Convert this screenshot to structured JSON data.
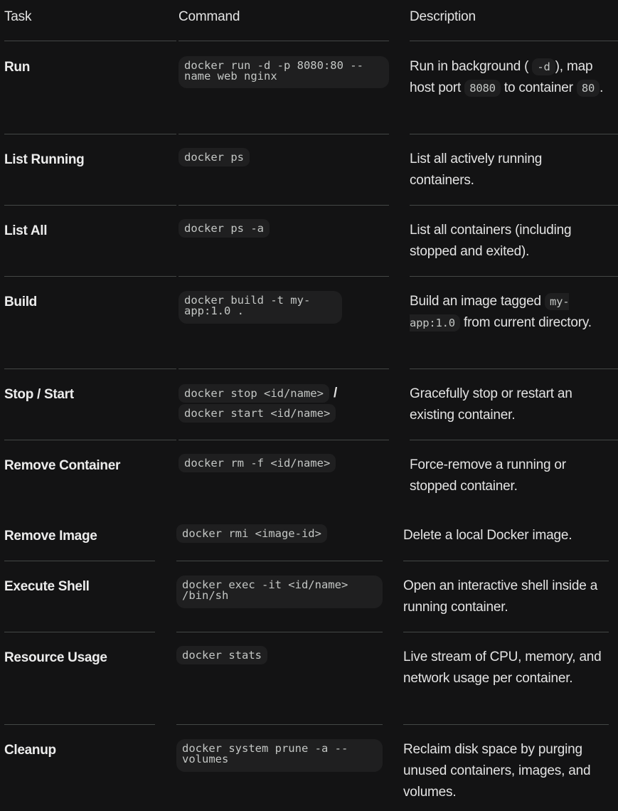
{
  "headers": {
    "task": "Task",
    "command": "Command",
    "description": "Description"
  },
  "rows": [
    {
      "task": "Run",
      "command": "docker run -d -p 8080:80 --name web nginx",
      "desc": {
        "p1": "Run in background (",
        "c1": "-d",
        "p2": "), map host port",
        "c2": "8080",
        "p3": "to container",
        "c3": "80",
        "p4": "."
      }
    },
    {
      "task": "List Running",
      "command": "docker ps",
      "desc": "List all actively running containers."
    },
    {
      "task": "List All",
      "command": "docker ps -a",
      "desc": "List all containers (including stopped and exited)."
    },
    {
      "task": "Build",
      "command": "docker build -t my-app:1.0 .",
      "desc": {
        "p1": "Build an image tagged",
        "c1": "my-app:1.0",
        "p2": "from current directory."
      }
    },
    {
      "task": "Stop / Start",
      "command_stop": "docker stop <id/name>",
      "separator": "/",
      "command_start": "docker start <id/name>",
      "desc": "Gracefully stop or restart an existing container."
    },
    {
      "task": "Remove Container",
      "command": "docker rm -f <id/name>",
      "desc": "Force-remove a running or stopped container."
    },
    {
      "task": "Remove Image",
      "command": "docker rmi <image-id>",
      "desc": "Delete a local Docker image."
    },
    {
      "task": "Execute Shell",
      "command": "docker exec -it <id/name> /bin/sh",
      "desc": "Open an interactive shell inside a running container."
    },
    {
      "task": "Resource Usage",
      "command": "docker stats",
      "desc": "Live stream of CPU, memory, and network usage per container."
    },
    {
      "task": "Cleanup",
      "command": "docker system prune -a --volumes",
      "desc": "Reclaim disk space by purging unused containers, images, and volumes."
    }
  ]
}
